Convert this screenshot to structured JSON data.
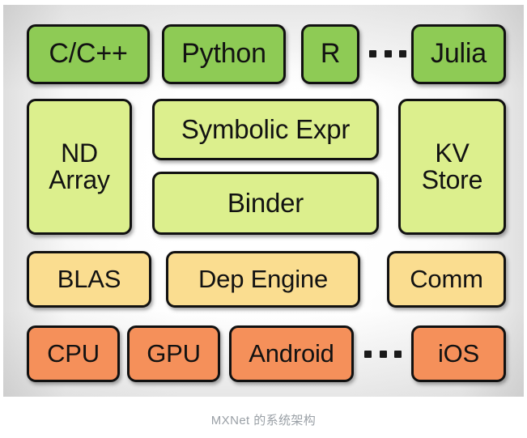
{
  "diagram": {
    "caption": "MXNet 的系统架构",
    "colors": {
      "language_layer": "#8ecb55",
      "api_layer": "#dcef8d",
      "system_layer": "#fadd90",
      "hardware_layer": "#f5905a",
      "border": "#111111",
      "caption_text": "#9aa0a6",
      "background": "#ffffff"
    },
    "layers": [
      {
        "name": "language-bindings",
        "boxes": [
          {
            "label": "C/C++"
          },
          {
            "label": "Python"
          },
          {
            "label": "R"
          },
          {
            "label": "Julia"
          }
        ],
        "ellipsis": true
      },
      {
        "name": "programming-api",
        "boxes": [
          {
            "label": "ND\nArray"
          },
          {
            "label": "Symbolic Expr"
          },
          {
            "label": "Binder"
          },
          {
            "label": "KV\nStore"
          }
        ],
        "ellipsis": false
      },
      {
        "name": "system-components",
        "boxes": [
          {
            "label": "BLAS"
          },
          {
            "label": "Dep Engine"
          },
          {
            "label": "Comm"
          }
        ],
        "ellipsis": false
      },
      {
        "name": "hardware-platforms",
        "boxes": [
          {
            "label": "CPU"
          },
          {
            "label": "GPU"
          },
          {
            "label": "Android"
          },
          {
            "label": "iOS"
          }
        ],
        "ellipsis": true
      }
    ]
  }
}
